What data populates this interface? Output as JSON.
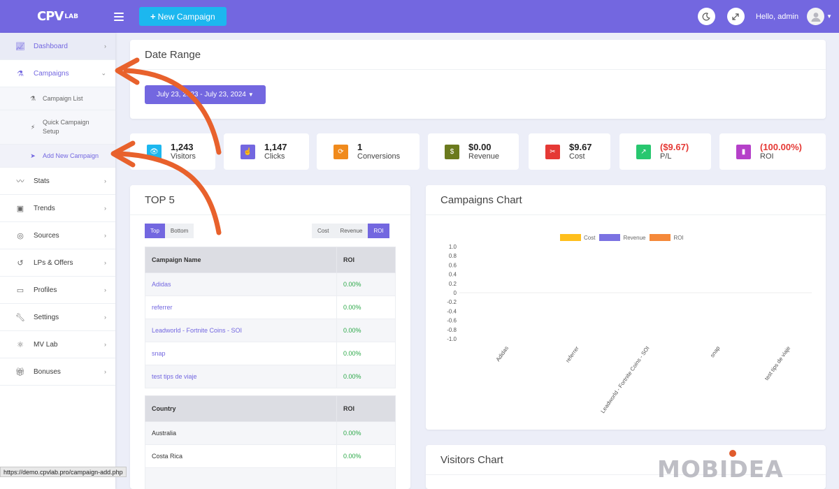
{
  "header": {
    "logo_main": "CPV",
    "logo_sub": "LAB",
    "new_campaign_label": "New Campaign",
    "greeting": "Hello, admin",
    "dark_mode_icon": "moon-icon",
    "fullscreen_icon": "expand-icon",
    "accent_color": "#7367e0"
  },
  "sidebar": {
    "items": [
      {
        "label": "Dashboard"
      },
      {
        "label": "Campaigns"
      },
      {
        "label": "Campaign List"
      },
      {
        "label": "Quick Campaign Setup"
      },
      {
        "label": "Add New Campaign"
      },
      {
        "label": "Stats"
      },
      {
        "label": "Trends"
      },
      {
        "label": "Sources"
      },
      {
        "label": "LPs & Offers"
      },
      {
        "label": "Profiles"
      },
      {
        "label": "Settings"
      },
      {
        "label": "MV Lab"
      },
      {
        "label": "Bonuses"
      }
    ]
  },
  "date_range": {
    "title": "Date Range",
    "value": "July 23, 2023 - July 23, 2024"
  },
  "stats": [
    {
      "value": "1,243",
      "label": "Visitors",
      "icon": "eye-icon",
      "color": "#1cb7ef"
    },
    {
      "value": "1,147",
      "label": "Clicks",
      "icon": "pointer-icon",
      "color": "#7367e0"
    },
    {
      "value": "1",
      "label": "Conversions",
      "icon": "refresh-icon",
      "color": "#f08a1c"
    },
    {
      "value": "$0.00",
      "label": "Revenue",
      "icon": "dollar-icon",
      "color": "#6b7a1e"
    },
    {
      "value": "$9.67",
      "label": "Cost",
      "icon": "scissors-icon",
      "color": "#e53935"
    },
    {
      "value": "($9.67)",
      "label": "P/L",
      "icon": "trend-icon",
      "color": "#28c76f"
    },
    {
      "value": "(100.00%)",
      "label": "ROI",
      "icon": "bar-chart-icon",
      "color": "#b540c9"
    }
  ],
  "top5": {
    "title": "TOP 5",
    "tab_top": "Top",
    "tab_bottom": "Bottom",
    "tab_cost": "Cost",
    "tab_revenue": "Revenue",
    "tab_roi": "ROI",
    "campaign_header": "Campaign Name",
    "roi_header": "ROI",
    "campaigns": [
      {
        "name": "Adidas",
        "roi": "0.00%"
      },
      {
        "name": "referrer",
        "roi": "0.00%"
      },
      {
        "name": "Leadworld - Fortnite Coins - SOI",
        "roi": "0.00%"
      },
      {
        "name": "snap",
        "roi": "0.00%"
      },
      {
        "name": "test tips de viaje",
        "roi": "0.00%"
      }
    ],
    "country_header": "Country",
    "country_roi_header": "ROI",
    "countries": [
      {
        "name": "Australia",
        "roi": "0.00%"
      },
      {
        "name": "Costa Rica",
        "roi": "0.00%"
      }
    ]
  },
  "campaigns_chart": {
    "title": "Campaigns Chart"
  },
  "chart_data": {
    "type": "bar",
    "categories": [
      "Adidas",
      "referrer",
      "Leadworld - Fortnite Coins - SOI",
      "snap",
      "test tips de viaje"
    ],
    "series": [
      {
        "name": "Cost",
        "values": [
          0,
          0,
          0,
          0,
          0
        ],
        "color": "#ffbf1c"
      },
      {
        "name": "Revenue",
        "values": [
          0,
          0,
          0,
          0,
          0
        ],
        "color": "#7b72e2"
      },
      {
        "name": "ROI",
        "values": [
          0,
          0,
          0,
          0,
          0
        ],
        "color": "#f5893a"
      }
    ],
    "ylim": [
      -1.0,
      1.0
    ],
    "yticks": [
      "1.0",
      "0.8",
      "0.6",
      "0.4",
      "0.2",
      "0",
      "-0.2",
      "-0.4",
      "-0.6",
      "-0.8",
      "-1.0"
    ],
    "legend": "top"
  },
  "visitors_chart": {
    "title": "Visitors Chart"
  },
  "status_url": "https://demo.cpvlab.pro/campaign-add.php",
  "watermark": "MOBIDEA"
}
